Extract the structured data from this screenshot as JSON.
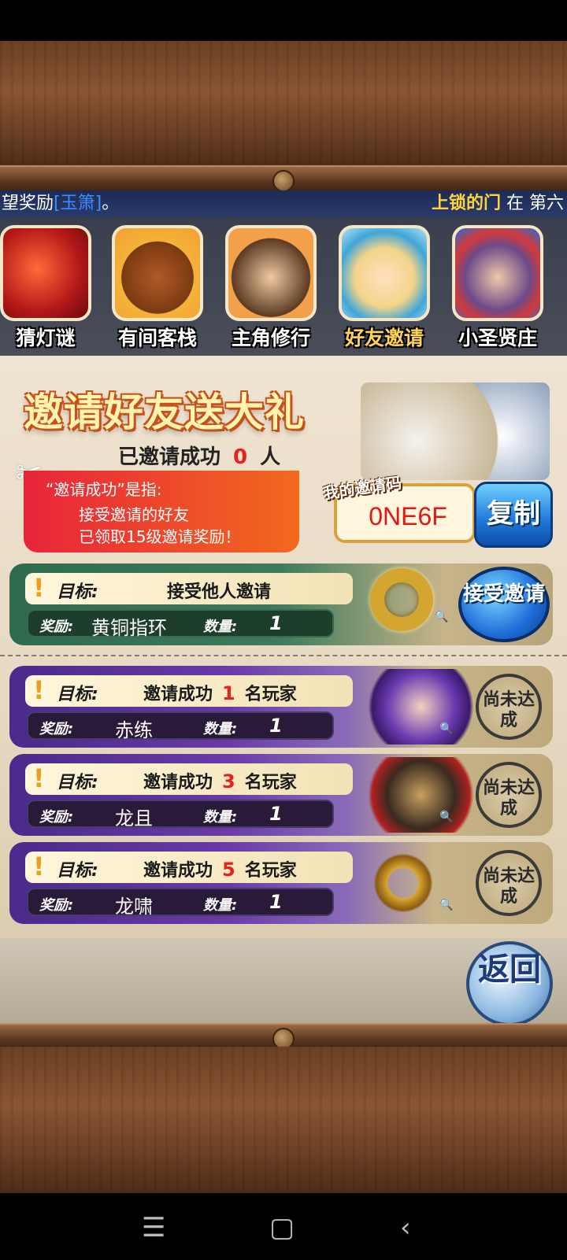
{
  "ticker": {
    "left_prefix": "望奖励",
    "left_highlight": "[玉箫]",
    "left_suffix": "。",
    "right_highlight": "上锁的门",
    "right_text": " 在 第六"
  },
  "tabs": [
    {
      "label": "猜灯谜"
    },
    {
      "label": "有间客栈"
    },
    {
      "label": "主角修行"
    },
    {
      "label": "好友邀请",
      "active": true
    },
    {
      "label": "小圣贤庄"
    }
  ],
  "invite": {
    "title": "邀请好友送大礼",
    "success_prefix": "已邀请成功",
    "success_count": "0",
    "success_suffix": "人",
    "note_line1": "“邀请成功”是指:",
    "note_line2": "接受邀请的好友",
    "note_line3": "已领取15级邀请奖励！",
    "code_label": "我的邀请码",
    "code": "0NE6F",
    "copy_label": "复制"
  },
  "labels": {
    "goal": "目标:",
    "reward": "奖励:",
    "quantity": "数量:",
    "exclaim": "!"
  },
  "tasks": [
    {
      "goal_text": "接受他人邀请",
      "reward": "黄铜指环",
      "quantity": "1",
      "action": "接受邀请"
    },
    {
      "goal_prefix": "邀请成功",
      "goal_num": "1",
      "goal_suffix": "名玩家",
      "reward": "赤练",
      "quantity": "1",
      "status": "尚未达成"
    },
    {
      "goal_prefix": "邀请成功",
      "goal_num": "3",
      "goal_suffix": "名玩家",
      "reward": "龙且",
      "quantity": "1",
      "status": "尚未达成"
    },
    {
      "goal_prefix": "邀请成功",
      "goal_num": "5",
      "goal_suffix": "名玩家",
      "reward": "龙啸",
      "quantity": "1",
      "status": "尚未达成"
    }
  ],
  "back_label": "返回",
  "nav": {
    "menu": "☰",
    "home": "▢",
    "back": "‹"
  }
}
